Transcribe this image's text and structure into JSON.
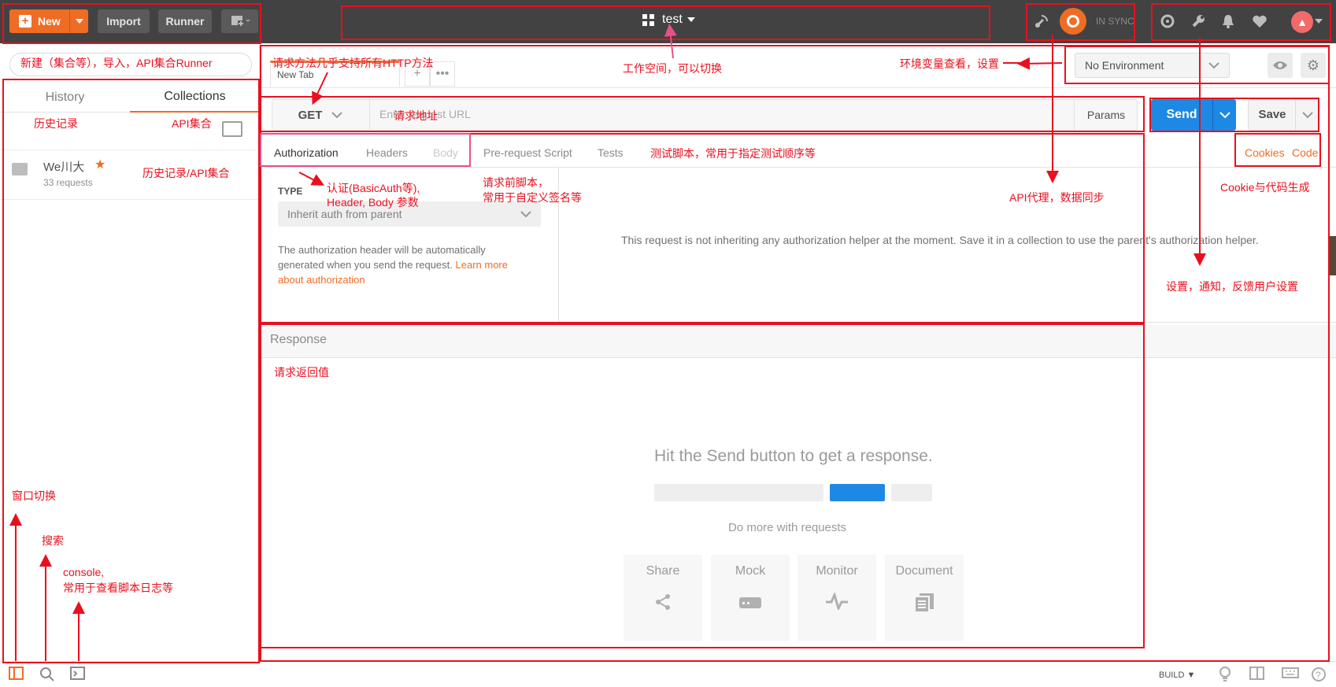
{
  "topbar": {
    "new_label": "New",
    "import_label": "Import",
    "runner_label": "Runner",
    "workspace": "test",
    "sync_status": "IN SYNC"
  },
  "sidebar": {
    "tabs": [
      "History",
      "Collections"
    ],
    "collection": {
      "name": "We川大",
      "count": "33 requests"
    }
  },
  "request": {
    "tab_label": "New Tab",
    "method": "GET",
    "url_placeholder": "Enter request URL",
    "params_label": "Params",
    "send_label": "Send",
    "save_label": "Save"
  },
  "environment": {
    "selected": "No Environment"
  },
  "subtabs": {
    "authorization": "Authorization",
    "headers": "Headers",
    "body": "Body",
    "prerequest": "Pre-request Script",
    "tests": "Tests",
    "cookies": "Cookies",
    "code": "Code"
  },
  "auth": {
    "type_label": "TYPE",
    "type_value": "Inherit auth from parent",
    "desc_1": "The authorization header will be automatically",
    "desc_2": "generated when you send the request.",
    "learn_more_1": "Learn more",
    "learn_more_2": "about authorization",
    "message": "This request is not inheriting any authorization helper at the moment. Save it in a collection to use the parent's authorization helper."
  },
  "response": {
    "title": "Response",
    "hint": "Hit the Send button to get a response.",
    "more": "Do more with requests",
    "cards": [
      "Share",
      "Mock",
      "Monitor",
      "Document"
    ]
  },
  "footer": {
    "build": "BUILD"
  },
  "annotations": {
    "new_import": "新建（集合等），导入，API集合Runner",
    "methods": "请求方法几乎支持所有HTTP方法",
    "workspace": "工作空间，可以切换",
    "env": "环境变量查看，设置",
    "url": "请求地址",
    "history": "历史记录",
    "api_collection": "API集合",
    "hist_coll": "历史记录/API集合",
    "auth_1": "认证(BasicAuth等),",
    "auth_2": "Header, Body 参数",
    "prereq_1": "请求前脚本，",
    "prereq_2": "常用于自定义签名等",
    "tests": "测试脚本，常用于指定测试顺序等",
    "proxy": "API代理，数据同步",
    "cookie_code": "Cookie与代码生成",
    "settings": "设置，通知，反馈用户设置",
    "response_value": "请求返回值",
    "window_switch": "窗口切换",
    "search": "搜索",
    "console_1": "console,",
    "console_2": "常用于查看脚本日志等"
  },
  "colors": {
    "accent": "#ef6c24",
    "send": "#1e88e5",
    "annotation": "#e8101e"
  }
}
